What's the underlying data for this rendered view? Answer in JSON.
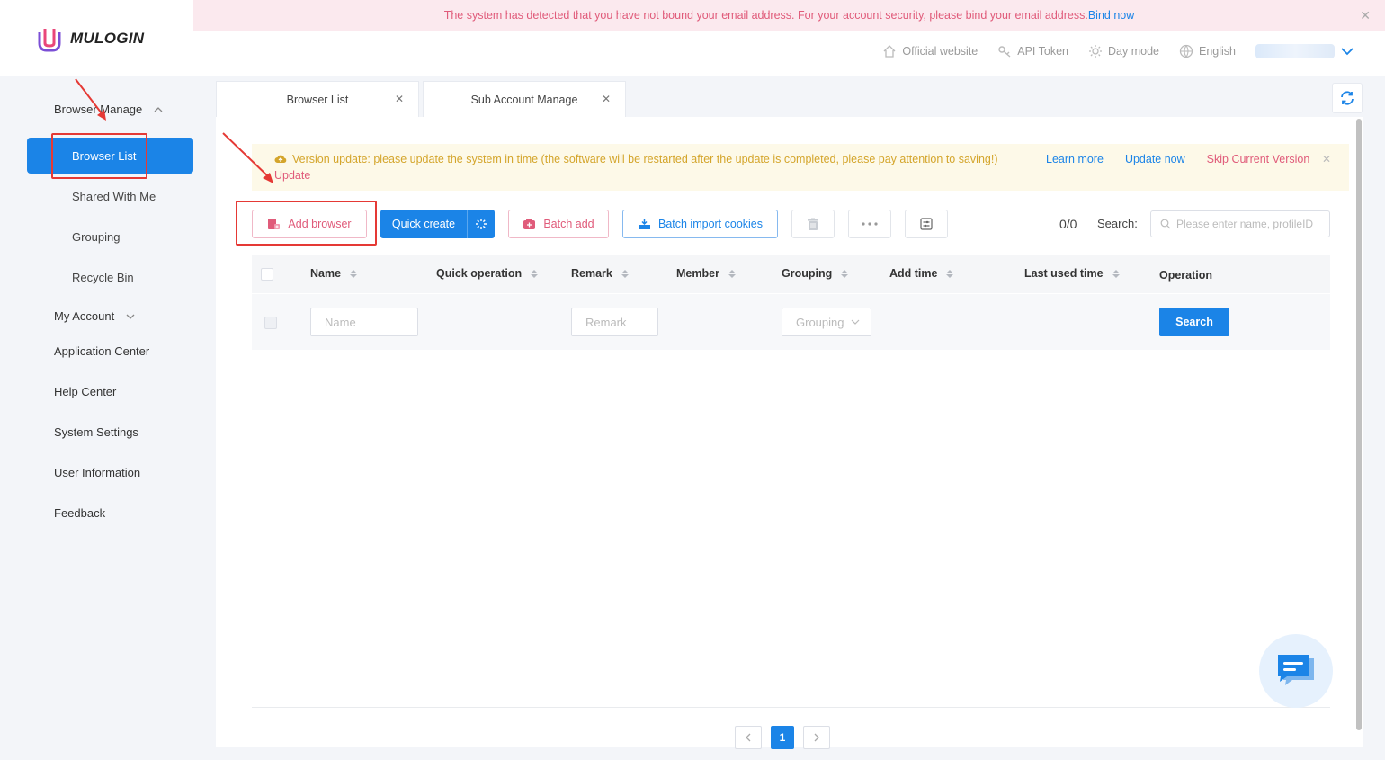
{
  "app": {
    "logo_text": "MULOGIN"
  },
  "notice": {
    "message": "The system has detected that you have not bound your email address. For your account security, please bind your email address.",
    "action": "Bind now"
  },
  "header": {
    "official_website": "Official website",
    "api_token": "API Token",
    "day_mode": "Day mode",
    "language": "English"
  },
  "sidebar": {
    "browser_manage": "Browser Manage",
    "browser_list": "Browser List",
    "shared_with_me": "Shared With Me",
    "grouping": "Grouping",
    "recycle_bin": "Recycle Bin",
    "my_account": "My Account",
    "application_center": "Application Center",
    "help_center": "Help Center",
    "system_settings": "System Settings",
    "user_information": "User Information",
    "feedback": "Feedback"
  },
  "tabs": [
    {
      "label": "Browser List"
    },
    {
      "label": "Sub Account Manage"
    }
  ],
  "version_bar": {
    "message": "Version update: please update the system in time (the software will be restarted after the update is completed, please pay attention to saving!)",
    "second_line": "Update",
    "learn_more": "Learn more",
    "update_now": "Update now",
    "skip": "Skip Current Version"
  },
  "actions": {
    "add_browser": "Add browser",
    "quick_create": "Quick create",
    "batch_add": "Batch add",
    "batch_import_cookies": "Batch import cookies"
  },
  "count": "0/0",
  "search": {
    "label": "Search:",
    "placeholder": "Please enter name, profileID"
  },
  "table": {
    "columns": [
      "Name",
      "Quick operation",
      "Remark",
      "Member",
      "Grouping",
      "Add time",
      "Last used time",
      "Operation"
    ],
    "filters": {
      "name_placeholder": "Name",
      "remark_placeholder": "Remark",
      "grouping_placeholder": "Grouping",
      "search_button": "Search"
    }
  },
  "pagination": {
    "current": "1",
    "prev": "‹",
    "next": "›"
  },
  "colors": {
    "primary": "#1b84e7",
    "pink": "#e05b7a",
    "annotation_red": "#e53935",
    "warning": "#d4a52b"
  }
}
